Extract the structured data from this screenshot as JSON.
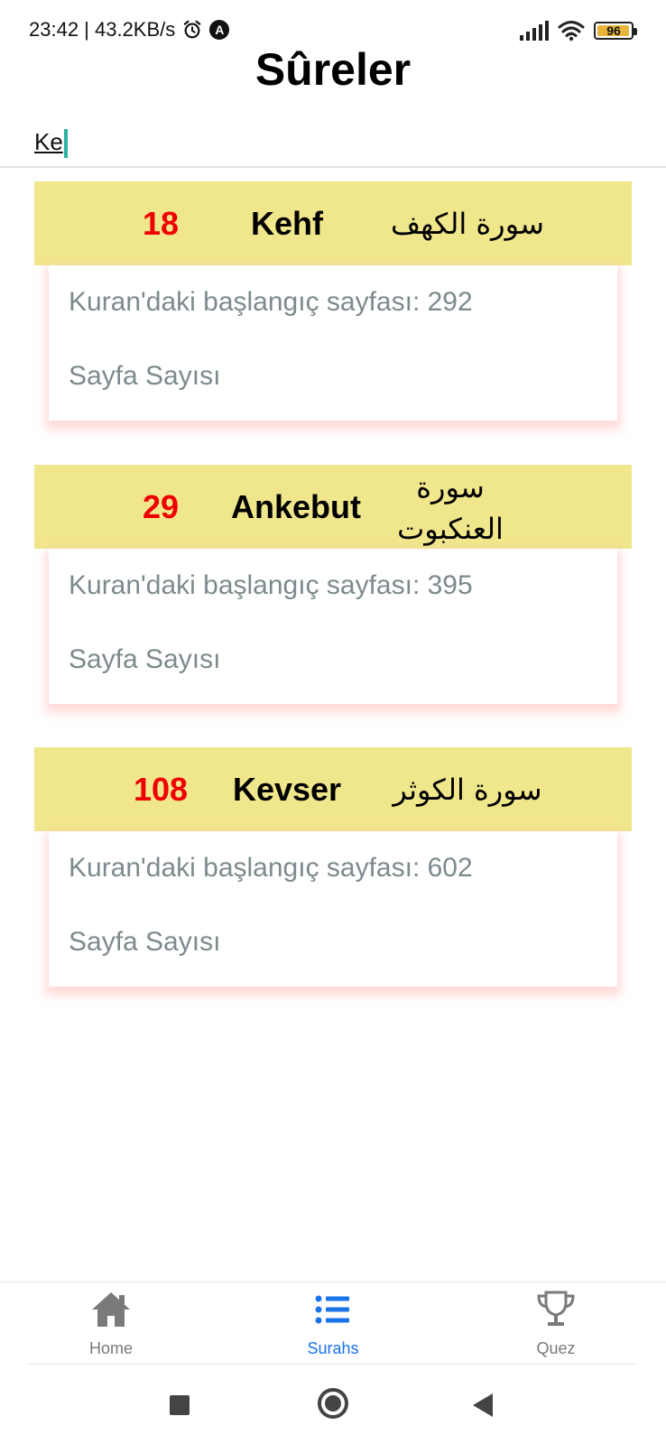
{
  "status_bar": {
    "time_speed": "23:42 | 43.2KB/s",
    "notification_icon": "A",
    "battery_percent": "96",
    "battery_level": 0.96
  },
  "title": "Sûreler",
  "search": {
    "value": "Ke"
  },
  "surahs": [
    {
      "number": "18",
      "name": "Kehf",
      "arabic": "سورة الكهف",
      "start_page": "Kuran'daki başlangıç sayfası: 292",
      "page_count": "Sayfa Sayısı"
    },
    {
      "number": "29",
      "name": "Ankebut",
      "arabic": "سورة العنكبوت",
      "start_page": "Kuran'daki başlangıç sayfası: 395",
      "page_count": "Sayfa Sayısı"
    },
    {
      "number": "108",
      "name": "Kevser",
      "arabic": "سورة الكوثر",
      "start_page": "Kuran'daki başlangıç sayfası: 602",
      "page_count": "Sayfa Sayısı"
    }
  ],
  "bottom_nav": {
    "home": "Home",
    "surahs": "Surahs",
    "quiz": "Quez",
    "active_color": "#1a73e8",
    "inactive_color": "#7a7a7a"
  },
  "colors": {
    "card_header": "#f0e68c",
    "number": "#ee0000",
    "body_text": "#7d8a8d"
  }
}
